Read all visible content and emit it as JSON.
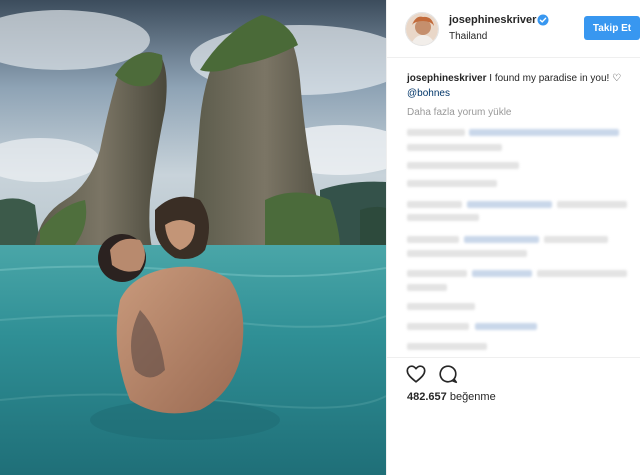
{
  "photo": {
    "description_icon": "photo"
  },
  "header": {
    "username": "josephineskriver",
    "location": "Thailand",
    "follow_label": "Takip Et",
    "verified_icon": "verified-badge-icon"
  },
  "caption": {
    "user": "josephineskriver",
    "text": " I found my paradise in you! ",
    "heart": "♡",
    "mention": "@bohnes"
  },
  "load_more": "Daha fazla yorum yükle",
  "actions": {
    "like_icon": "heart-icon",
    "comment_icon": "comment-icon"
  },
  "likes": {
    "count": "482.657",
    "label": "beğenme"
  },
  "colors": {
    "accent": "#3897f0",
    "text": "#262626",
    "muted": "#999999",
    "mention": "#003569",
    "water": "#3aa7a6",
    "sky": "#8fa7bd"
  }
}
